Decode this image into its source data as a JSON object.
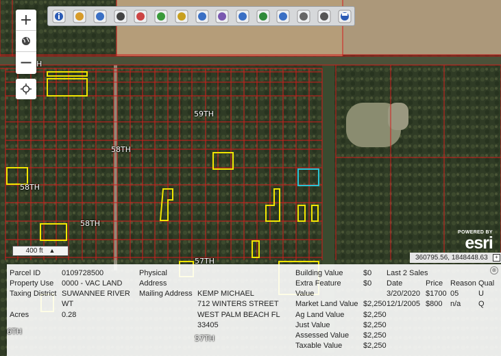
{
  "toolbar": {
    "tools": [
      "info-icon",
      "select-box-icon",
      "zoom-in-icon",
      "pan-icon",
      "eraser-icon",
      "add-layer-icon",
      "locate-person-icon",
      "basemap-icon",
      "measure-icon",
      "zoom-out-icon",
      "draw-pencil-icon",
      "print-icon",
      "layers-icon",
      "print-map-icon",
      "save-icon"
    ]
  },
  "map": {
    "zoom_in": "+",
    "zoom_out": "−",
    "streets": [
      "59TH",
      "58TH",
      "58TH",
      "58TH",
      "57TH",
      "H",
      "57TH",
      "6TH"
    ],
    "scale_label": "400 ft",
    "esri_powered_by": "POWERED BY",
    "esri_logo": "esri",
    "coordinates": "360795.56, 1848448.63"
  },
  "colors": {
    "parcel_line": "#d41c1c",
    "highlight": "#f2e600",
    "selected": "#29c5d6"
  },
  "info": {
    "labels": {
      "parcel_id": "Parcel ID",
      "property_use": "Property Use",
      "taxing_district": "Taxing District",
      "acres": "Acres",
      "physical_address_1": "Physical",
      "physical_address_2": "Address",
      "mailing_address": "Mailing Address"
    },
    "values": {
      "parcel_id": "0109728500",
      "property_use": "0000 - VAC LAND",
      "taxing_district_1": "SUWANNEE RIVER",
      "taxing_district_2": "WT",
      "acres": "0.28",
      "mailing_1": "KEMP MICHAEL",
      "mailing_2": "712 WINTERS STREET",
      "mailing_3": "WEST PALM BEACH FL",
      "mailing_4": "33405"
    },
    "values_section": {
      "building_value_label": "Building Value",
      "building_value": "$0",
      "extra_feature_label_1": "Extra Feature",
      "extra_feature_label_2": "Value",
      "extra_feature": "$0",
      "market_land_label": "Market Land Value",
      "market_land": "$2,250",
      "ag_land_label": "Ag Land Value",
      "ag_land": "$2,250",
      "just_label": "Just Value",
      "just": "$2,250",
      "assessed_label": "Assessed Value",
      "assessed": "$2,250",
      "taxable_label": "Taxable Value",
      "taxable": "$2,250"
    },
    "sales": {
      "title": "Last 2 Sales",
      "headers": [
        "Date",
        "Price",
        "Reason",
        "Qual"
      ],
      "rows": [
        [
          "3/20/2020",
          "$1700",
          "05",
          "U"
        ],
        [
          "12/1/2005",
          "$800",
          "n/a",
          "Q"
        ]
      ]
    },
    "close_icon": "⊗"
  }
}
